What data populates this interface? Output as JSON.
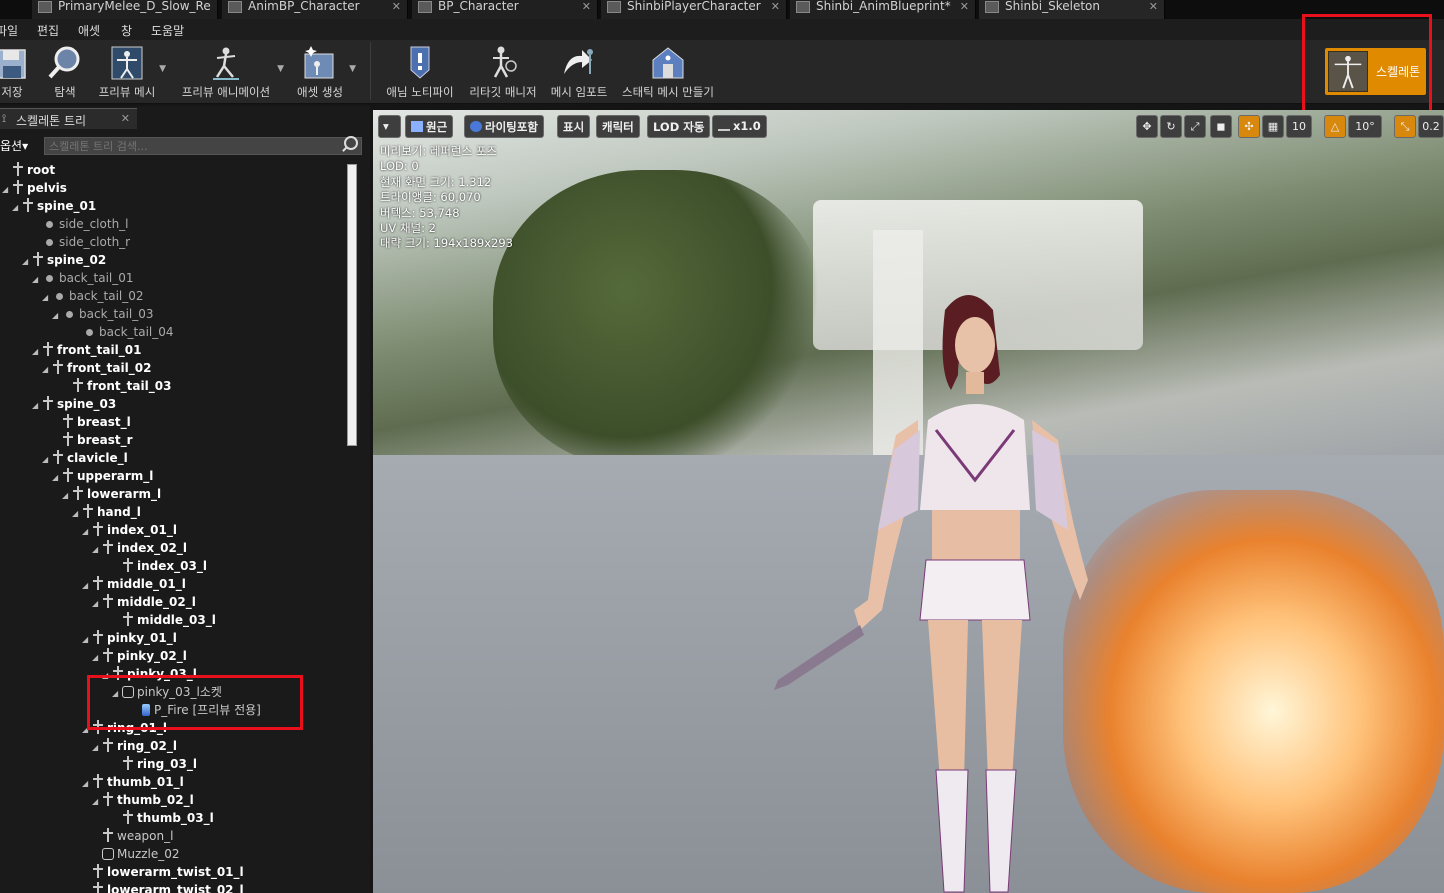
{
  "tabs": [
    {
      "label": "PrimaryMelee_D_Slow_Re"
    },
    {
      "label": "AnimBP_Character"
    },
    {
      "label": "BP_Character"
    },
    {
      "label": "ShinbiPlayerCharacter"
    },
    {
      "label": "Shinbi_AnimBlueprint*"
    },
    {
      "label": "Shinbi_Skeleton"
    }
  ],
  "menu": [
    "파일",
    "편집",
    "애셋",
    "창",
    "도움말"
  ],
  "toolbar": {
    "save": "저장",
    "browse": "탐색",
    "preview_mesh": "프리뷰 메시",
    "preview_animation": "프리뷰 애니메이션",
    "create_asset": "애셋 생성",
    "anim_notify": "애님 노티파이",
    "retarget_manager": "리타깃 매니저",
    "import_mesh": "메시 임포트",
    "make_static_mesh": "스태틱 메시 만들기",
    "skeleton_mode": "스켈레톤"
  },
  "panel": {
    "title": "스켈레톤 트리",
    "options": "옵션",
    "search_placeholder": "스켈레톤 트리 검색..."
  },
  "tree": [
    {
      "label": "root",
      "depth": 0,
      "icon": "bone",
      "style": "bold",
      "arrow": false
    },
    {
      "label": "pelvis",
      "depth": 0,
      "icon": "bone",
      "style": "bold",
      "arrow": true
    },
    {
      "label": "spine_01",
      "depth": 1,
      "icon": "bone",
      "style": "bold",
      "arrow": true
    },
    {
      "label": "side_cloth_l",
      "depth": 3,
      "icon": "dot",
      "style": "plain",
      "arrow": false
    },
    {
      "label": "side_cloth_r",
      "depth": 3,
      "icon": "dot",
      "style": "plain",
      "arrow": false
    },
    {
      "label": "spine_02",
      "depth": 2,
      "icon": "bone",
      "style": "bold",
      "arrow": true
    },
    {
      "label": "back_tail_01",
      "depth": 3,
      "icon": "dot",
      "style": "plain",
      "arrow": true
    },
    {
      "label": "back_tail_02",
      "depth": 4,
      "icon": "dot",
      "style": "plain",
      "arrow": true
    },
    {
      "label": "back_tail_03",
      "depth": 5,
      "icon": "dot",
      "style": "plain",
      "arrow": true
    },
    {
      "label": "back_tail_04",
      "depth": 7,
      "icon": "dot",
      "style": "plain",
      "arrow": false
    },
    {
      "label": "front_tail_01",
      "depth": 3,
      "icon": "bone",
      "style": "bold",
      "arrow": true
    },
    {
      "label": "front_tail_02",
      "depth": 4,
      "icon": "bone",
      "style": "bold",
      "arrow": true
    },
    {
      "label": "front_tail_03",
      "depth": 6,
      "icon": "bone",
      "style": "bold",
      "arrow": false
    },
    {
      "label": "spine_03",
      "depth": 3,
      "icon": "bone",
      "style": "bold",
      "arrow": true
    },
    {
      "label": "breast_l",
      "depth": 5,
      "icon": "bone",
      "style": "bold",
      "arrow": false
    },
    {
      "label": "breast_r",
      "depth": 5,
      "icon": "bone",
      "style": "bold",
      "arrow": false
    },
    {
      "label": "clavicle_l",
      "depth": 4,
      "icon": "bone",
      "style": "bold",
      "arrow": true
    },
    {
      "label": "upperarm_l",
      "depth": 5,
      "icon": "bone",
      "style": "bold",
      "arrow": true
    },
    {
      "label": "lowerarm_l",
      "depth": 6,
      "icon": "bone",
      "style": "bold",
      "arrow": true
    },
    {
      "label": "hand_l",
      "depth": 7,
      "icon": "bone",
      "style": "bold",
      "arrow": true
    },
    {
      "label": "index_01_l",
      "depth": 8,
      "icon": "bone",
      "style": "bold",
      "arrow": true
    },
    {
      "label": "index_02_l",
      "depth": 9,
      "icon": "bone",
      "style": "bold",
      "arrow": true
    },
    {
      "label": "index_03_l",
      "depth": 11,
      "icon": "bone",
      "style": "bold",
      "arrow": false
    },
    {
      "label": "middle_01_l",
      "depth": 8,
      "icon": "bone",
      "style": "bold",
      "arrow": true
    },
    {
      "label": "middle_02_l",
      "depth": 9,
      "icon": "bone",
      "style": "bold",
      "arrow": true
    },
    {
      "label": "middle_03_l",
      "depth": 11,
      "icon": "bone",
      "style": "bold",
      "arrow": false
    },
    {
      "label": "pinky_01_l",
      "depth": 8,
      "icon": "bone",
      "style": "bold",
      "arrow": true
    },
    {
      "label": "pinky_02_l",
      "depth": 9,
      "icon": "bone",
      "style": "bold",
      "arrow": true
    },
    {
      "label": "pinky_03_l",
      "depth": 10,
      "icon": "bone",
      "style": "bold",
      "arrow": true
    },
    {
      "label": "pinky_03_l소켓",
      "depth": 11,
      "icon": "socket",
      "style": "normal",
      "arrow": true
    },
    {
      "label": "P_Fire [프리뷰 전용]",
      "depth": 13,
      "icon": "fx",
      "style": "normal",
      "arrow": false
    },
    {
      "label": "ring_01_l",
      "depth": 8,
      "icon": "bone",
      "style": "bold",
      "arrow": true
    },
    {
      "label": "ring_02_l",
      "depth": 9,
      "icon": "bone",
      "style": "bold",
      "arrow": true
    },
    {
      "label": "ring_03_l",
      "depth": 11,
      "icon": "bone",
      "style": "bold",
      "arrow": false
    },
    {
      "label": "thumb_01_l",
      "depth": 8,
      "icon": "bone",
      "style": "bold",
      "arrow": true
    },
    {
      "label": "thumb_02_l",
      "depth": 9,
      "icon": "bone",
      "style": "bold",
      "arrow": true
    },
    {
      "label": "thumb_03_l",
      "depth": 11,
      "icon": "bone",
      "style": "bold",
      "arrow": false
    },
    {
      "label": "weapon_l",
      "depth": 9,
      "icon": "bone",
      "style": "normal",
      "arrow": false
    },
    {
      "label": "Muzzle_02",
      "depth": 9,
      "icon": "socket",
      "style": "normal",
      "arrow": false
    },
    {
      "label": "lowerarm_twist_01_l",
      "depth": 8,
      "icon": "bone",
      "style": "bold",
      "arrow": false
    },
    {
      "label": "lowerarm_twist_02_l",
      "depth": 8,
      "icon": "bone",
      "style": "bold",
      "arrow": false
    }
  ],
  "viewport": {
    "buttons": [
      "원근",
      "라이팅포함",
      "표시",
      "캐릭터",
      "LOD 자동",
      "x1.0"
    ],
    "grid_snap": "10",
    "rot_snap": "10°",
    "scale_snap": "0.2",
    "info": [
      "미리보기: 레퍼런스 포즈",
      "LOD: 0",
      "현재 화면 크기: 1.312",
      "트라이앵글: 60,070",
      "버텍스: 53,748",
      "UV 채널: 2",
      "대략 크기: 194x189x293"
    ]
  },
  "colors": {
    "accent": "#e08a00",
    "highlight": "#e8101a"
  }
}
